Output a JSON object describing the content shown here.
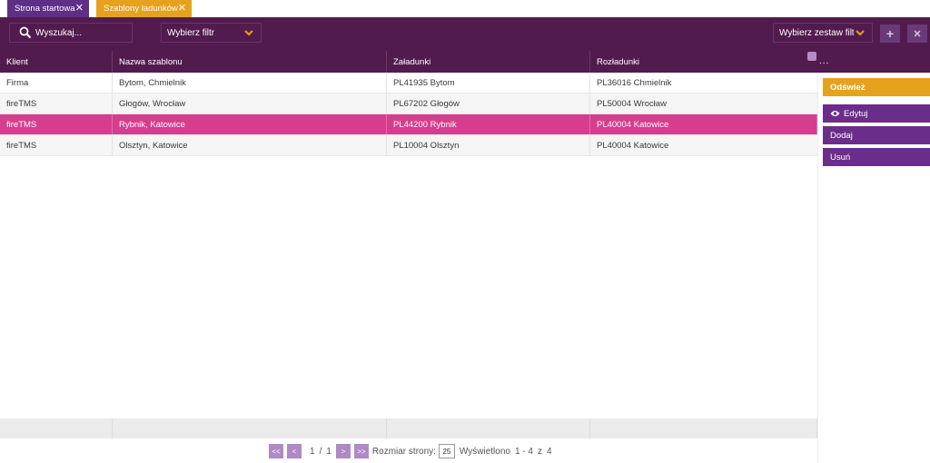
{
  "tabs": [
    {
      "label": "Strona startowa",
      "close": "✕"
    },
    {
      "label": "Szablony ładunków",
      "close": "✕"
    }
  ],
  "toolbar": {
    "search_placeholder": "Wyszukaj...",
    "filter_label": "Wybierz filtr",
    "filterset_label": "Wybierz zestaw filtrów",
    "plus_label": "+",
    "x_label": "✕"
  },
  "grid": {
    "columns": [
      "Klient",
      "Nazwa szablonu",
      "Załadunki",
      "Rozładunki"
    ],
    "more": "...",
    "rows": [
      {
        "client": "Firma",
        "name": "Bytom, Chmielnik",
        "loading": "PL41935 Bytom",
        "unloading": "PL36016 Chmielnik"
      },
      {
        "client": "fireTMS",
        "name": "Głogów, Wrocław",
        "loading": "PL67202 Głogów",
        "unloading": "PL50004 Wrocław"
      },
      {
        "client": "fireTMS",
        "name": "Rybnik, Katowice",
        "loading": "PL44200 Rybnik",
        "unloading": "PL40004 Katowice"
      },
      {
        "client": "fireTMS",
        "name": "Olsztyn, Katowice",
        "loading": "PL10004 Olsztyn",
        "unloading": "PL40004 Katowice"
      }
    ],
    "selected_row": 2
  },
  "side": {
    "refresh": "Odśwież",
    "edit": "Edytuj",
    "add": "Dodaj",
    "delete": "Usuń"
  },
  "pager": {
    "first": "<<",
    "prev": "<",
    "next": ">",
    "last": ">>",
    "page": "1",
    "sep": "/",
    "total_pages": "1",
    "size_label": "Rozmiar strony:",
    "size_value": "25",
    "shown_label": "Wyświetlono",
    "range": "1 - 4",
    "of": "z",
    "total": "4"
  },
  "colors": {
    "toolbar": "#521b4d",
    "tab_active": "#e6a11f",
    "tab_inactive": "#5e2f86",
    "selected_row": "#d63d8f",
    "side_button": "#6b2d8a",
    "refresh_button": "#e6a11f"
  }
}
